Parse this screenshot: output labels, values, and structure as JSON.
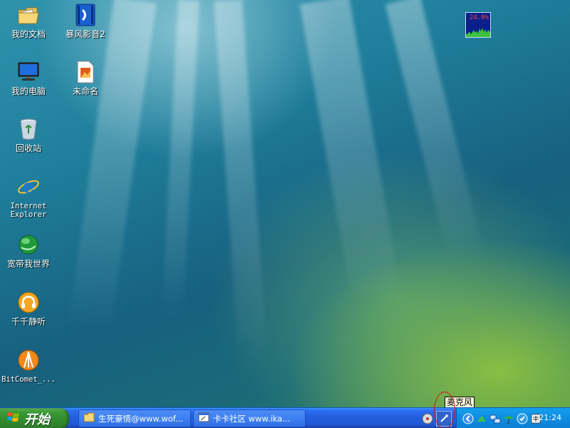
{
  "desktop": {
    "icons": [
      {
        "label": "我的文档"
      },
      {
        "label": "暴风影音2"
      },
      {
        "label": "我的电脑"
      },
      {
        "label": "未命名"
      },
      {
        "label": "回收站"
      },
      {
        "label": "Internet\nExplorer"
      },
      {
        "label": "宽带我世界"
      },
      {
        "label": "千千静听"
      },
      {
        "label": "BitComet_..."
      }
    ],
    "cpu_meter": {
      "percent": "24.0%"
    },
    "tooltip": "麦克风"
  },
  "taskbar": {
    "start_label": "开始",
    "tasks": [
      {
        "label": "生死豪情@www.wof..."
      },
      {
        "label": "卡卡社区 www.ika..."
      }
    ],
    "clock": "21:24"
  },
  "icons": {
    "my_documents": "folder-document-icon",
    "storm_player": "media-player-icon",
    "my_computer": "computer-monitor-icon",
    "untitled": "image-file-icon",
    "recycle_bin": "recycle-bin-icon",
    "internet_explorer": "internet-explorer-icon",
    "broadband_world": "globe-icon",
    "ttplayer": "headphones-icon",
    "bitcomet": "bitcomet-icon"
  },
  "colors": {
    "taskbar_blue": "#245edb",
    "start_green": "#3c9a37",
    "tray_blue": "#0f8fe3",
    "tooltip_bg": "#ffffe1",
    "annotation_red": "#e01010"
  }
}
